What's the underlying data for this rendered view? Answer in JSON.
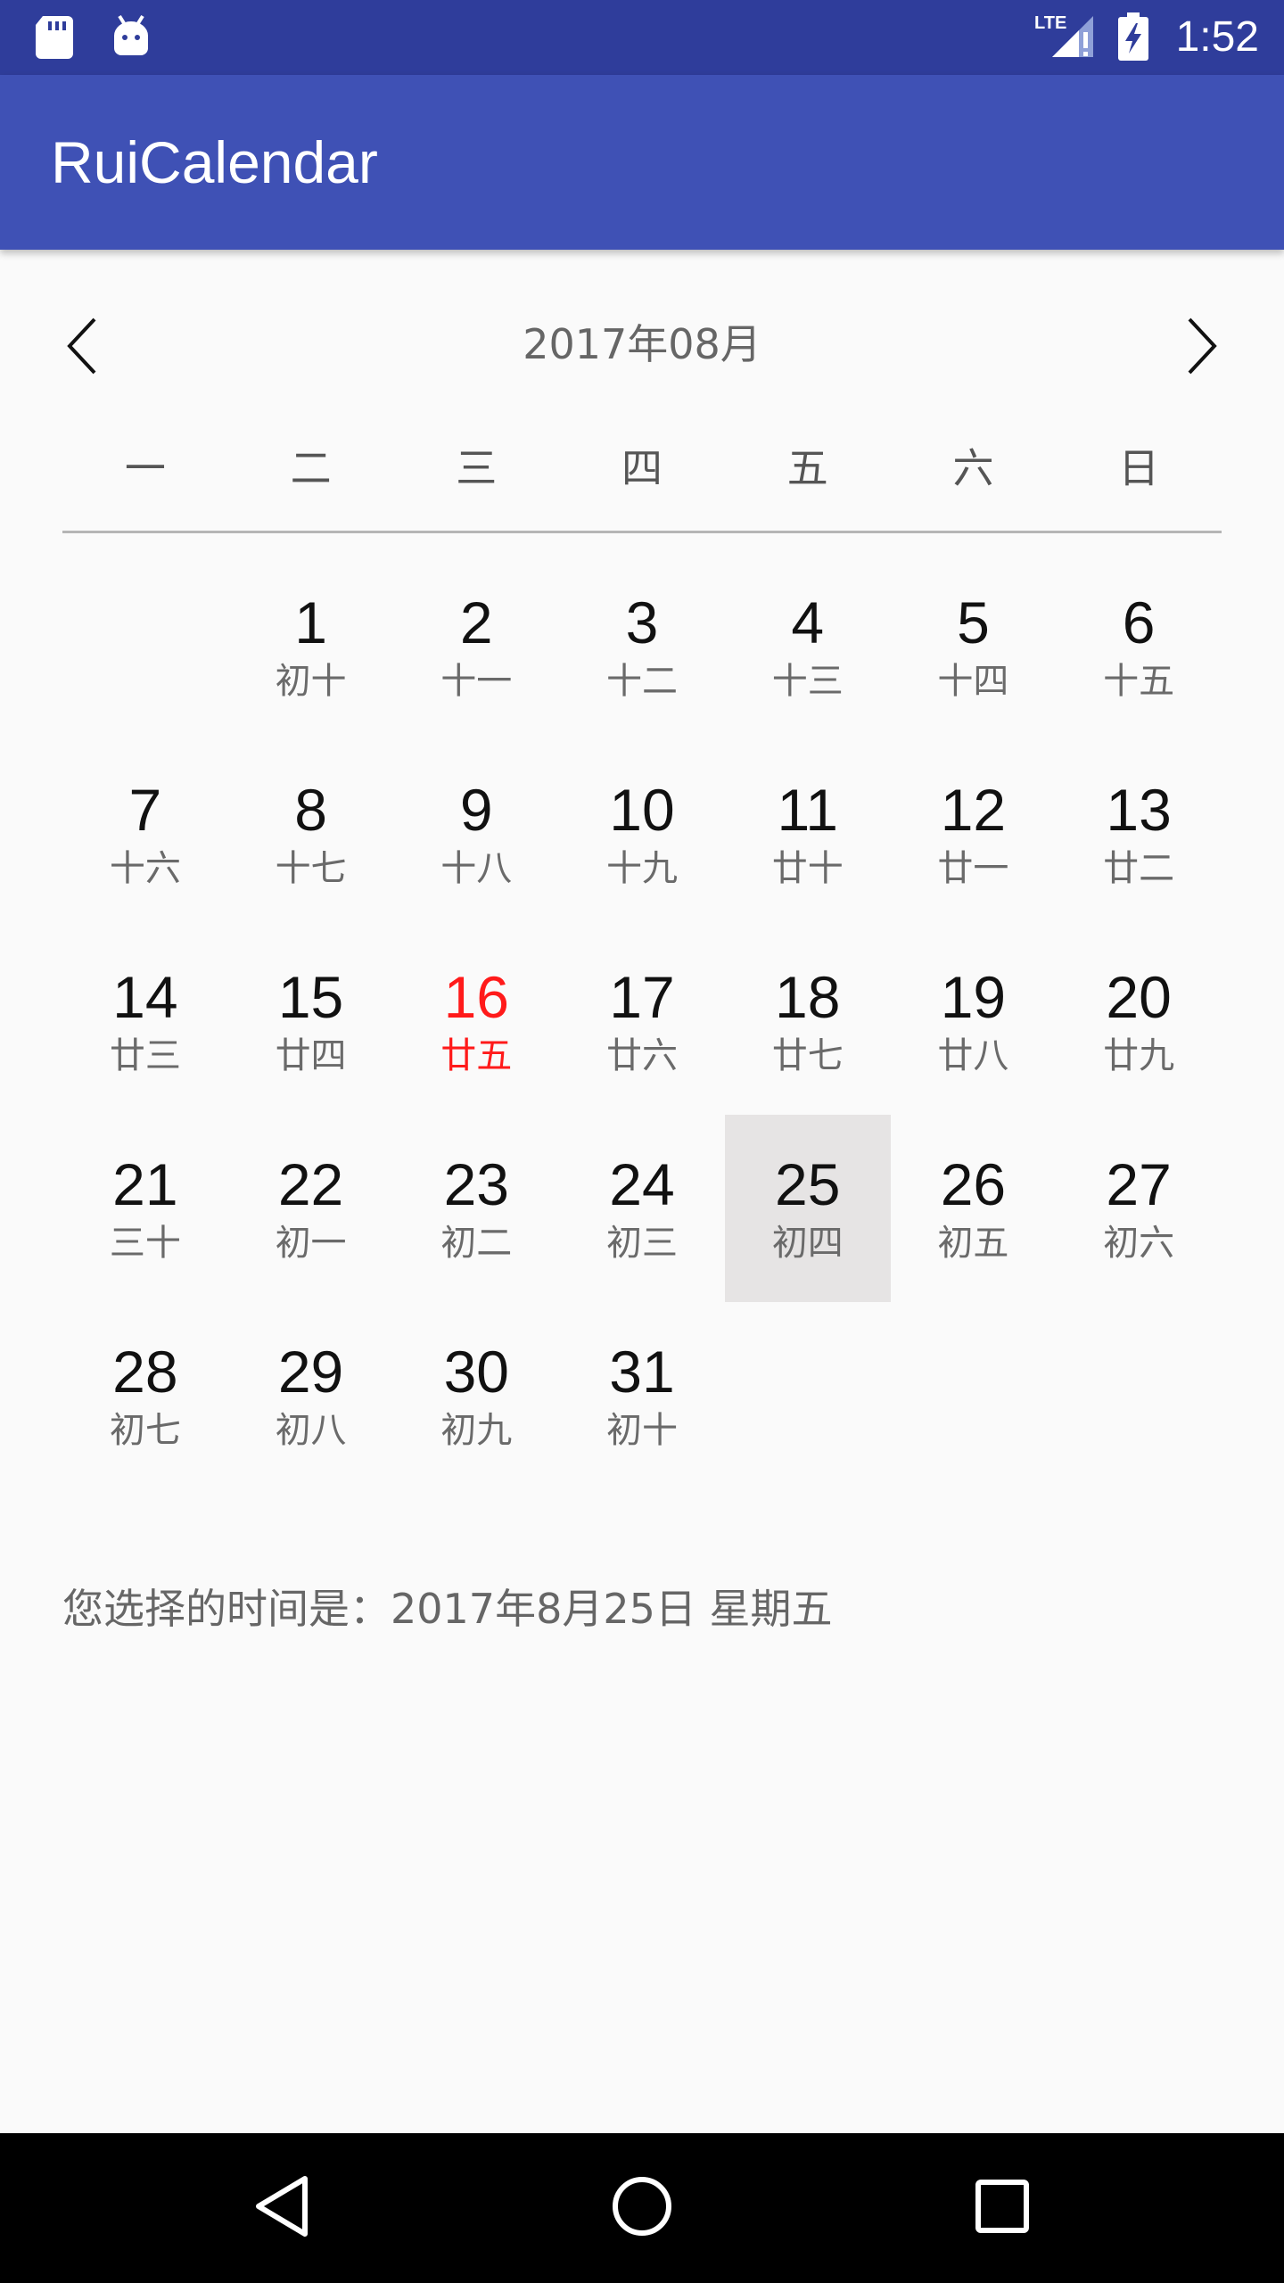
{
  "status_bar": {
    "time": "1:52",
    "icons": [
      "sd-card-icon",
      "android-icon",
      "lte-signal-icon",
      "battery-charging-icon"
    ]
  },
  "app_bar": {
    "title": "RuiCalendar"
  },
  "calendar": {
    "month_label": "2017年08月",
    "prev_icon": "chevron-left-icon",
    "next_icon": "chevron-right-icon",
    "weekdays": [
      "一",
      "二",
      "三",
      "四",
      "五",
      "六",
      "日"
    ],
    "leading_blank_days": 1,
    "today_day": "16",
    "selected_day": "25",
    "days": [
      {
        "day": "1",
        "lunar": "初十"
      },
      {
        "day": "2",
        "lunar": "十一"
      },
      {
        "day": "3",
        "lunar": "十二"
      },
      {
        "day": "4",
        "lunar": "十三"
      },
      {
        "day": "5",
        "lunar": "十四"
      },
      {
        "day": "6",
        "lunar": "十五"
      },
      {
        "day": "7",
        "lunar": "十六"
      },
      {
        "day": "8",
        "lunar": "十七"
      },
      {
        "day": "9",
        "lunar": "十八"
      },
      {
        "day": "10",
        "lunar": "十九"
      },
      {
        "day": "11",
        "lunar": "廿十"
      },
      {
        "day": "12",
        "lunar": "廿一"
      },
      {
        "day": "13",
        "lunar": "廿二"
      },
      {
        "day": "14",
        "lunar": "廿三"
      },
      {
        "day": "15",
        "lunar": "廿四"
      },
      {
        "day": "16",
        "lunar": "廿五"
      },
      {
        "day": "17",
        "lunar": "廿六"
      },
      {
        "day": "18",
        "lunar": "廿七"
      },
      {
        "day": "19",
        "lunar": "廿八"
      },
      {
        "day": "20",
        "lunar": "廿九"
      },
      {
        "day": "21",
        "lunar": "三十"
      },
      {
        "day": "22",
        "lunar": "初一"
      },
      {
        "day": "23",
        "lunar": "初二"
      },
      {
        "day": "24",
        "lunar": "初三"
      },
      {
        "day": "25",
        "lunar": "初四"
      },
      {
        "day": "26",
        "lunar": "初五"
      },
      {
        "day": "27",
        "lunar": "初六"
      },
      {
        "day": "28",
        "lunar": "初七"
      },
      {
        "day": "29",
        "lunar": "初八"
      },
      {
        "day": "30",
        "lunar": "初九"
      },
      {
        "day": "31",
        "lunar": "初十"
      }
    ]
  },
  "selection": {
    "text": "您选择的时间是：2017年8月25日  星期五"
  },
  "nav_bar": {
    "icons": [
      "back-icon",
      "home-icon",
      "recents-icon"
    ]
  },
  "colors": {
    "status_bar": "#2f3d9b",
    "app_bar": "#3f51b5",
    "today": "#ff1a1a",
    "selected_bg": "#e6e4e4"
  }
}
